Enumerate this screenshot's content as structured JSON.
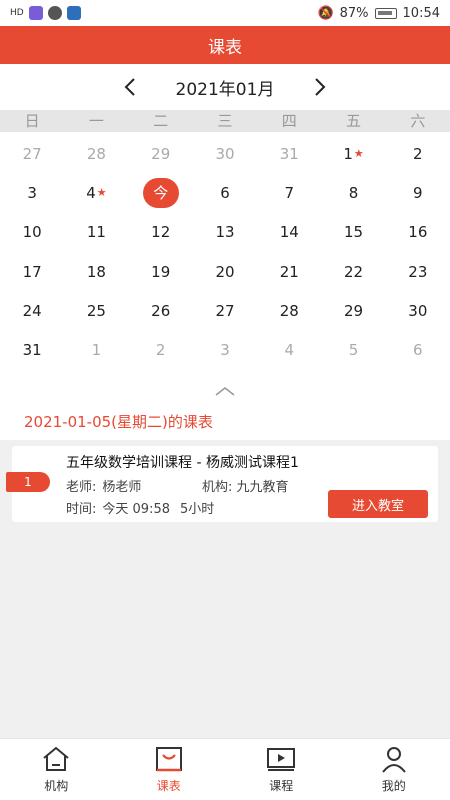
{
  "status": {
    "battery": "87%",
    "time": "10:54",
    "network_label": "HD"
  },
  "header": {
    "title": "课表"
  },
  "month": {
    "title": "2021年01月",
    "prev_icon": "chevron-left-icon",
    "next_icon": "chevron-right-icon"
  },
  "weekdays": [
    "日",
    "一",
    "二",
    "三",
    "四",
    "五",
    "六"
  ],
  "calendar": {
    "weeks": [
      [
        {
          "d": "27",
          "other": true
        },
        {
          "d": "28",
          "other": true
        },
        {
          "d": "29",
          "other": true
        },
        {
          "d": "30",
          "other": true
        },
        {
          "d": "31",
          "other": true
        },
        {
          "d": "1",
          "star": true
        },
        {
          "d": "2"
        }
      ],
      [
        {
          "d": "3"
        },
        {
          "d": "4",
          "star": true
        },
        {
          "d": "今",
          "today": true
        },
        {
          "d": "6"
        },
        {
          "d": "7"
        },
        {
          "d": "8"
        },
        {
          "d": "9"
        }
      ],
      [
        {
          "d": "10"
        },
        {
          "d": "11"
        },
        {
          "d": "12"
        },
        {
          "d": "13"
        },
        {
          "d": "14"
        },
        {
          "d": "15"
        },
        {
          "d": "16"
        }
      ],
      [
        {
          "d": "17"
        },
        {
          "d": "18"
        },
        {
          "d": "19"
        },
        {
          "d": "20"
        },
        {
          "d": "21"
        },
        {
          "d": "22"
        },
        {
          "d": "23"
        }
      ],
      [
        {
          "d": "24"
        },
        {
          "d": "25"
        },
        {
          "d": "26"
        },
        {
          "d": "27"
        },
        {
          "d": "28"
        },
        {
          "d": "29"
        },
        {
          "d": "30"
        }
      ],
      [
        {
          "d": "31"
        },
        {
          "d": "1",
          "other": true
        },
        {
          "d": "2",
          "other": true
        },
        {
          "d": "3",
          "other": true
        },
        {
          "d": "4",
          "other": true
        },
        {
          "d": "5",
          "other": true
        },
        {
          "d": "6",
          "other": true
        }
      ]
    ],
    "star_glyph": "★"
  },
  "day_title": "2021-01-05(星期二)的课表",
  "course": {
    "index": "1",
    "title": "五年级数学培训课程 - 杨威测试课程1",
    "teacher_label": "老师:",
    "teacher": "杨老师",
    "org_label": "机构:",
    "org": "九九教育",
    "time_label": "时间:",
    "time": "今天 09:58",
    "duration": "5小时",
    "enter_label": "进入教室"
  },
  "tabs": [
    {
      "label": "机构",
      "icon": "home-icon",
      "active": false
    },
    {
      "label": "课表",
      "icon": "schedule-icon",
      "active": true
    },
    {
      "label": "课程",
      "icon": "play-icon",
      "active": false
    },
    {
      "label": "我的",
      "icon": "user-icon",
      "active": false
    }
  ],
  "colors": {
    "accent": "#e64a33"
  }
}
